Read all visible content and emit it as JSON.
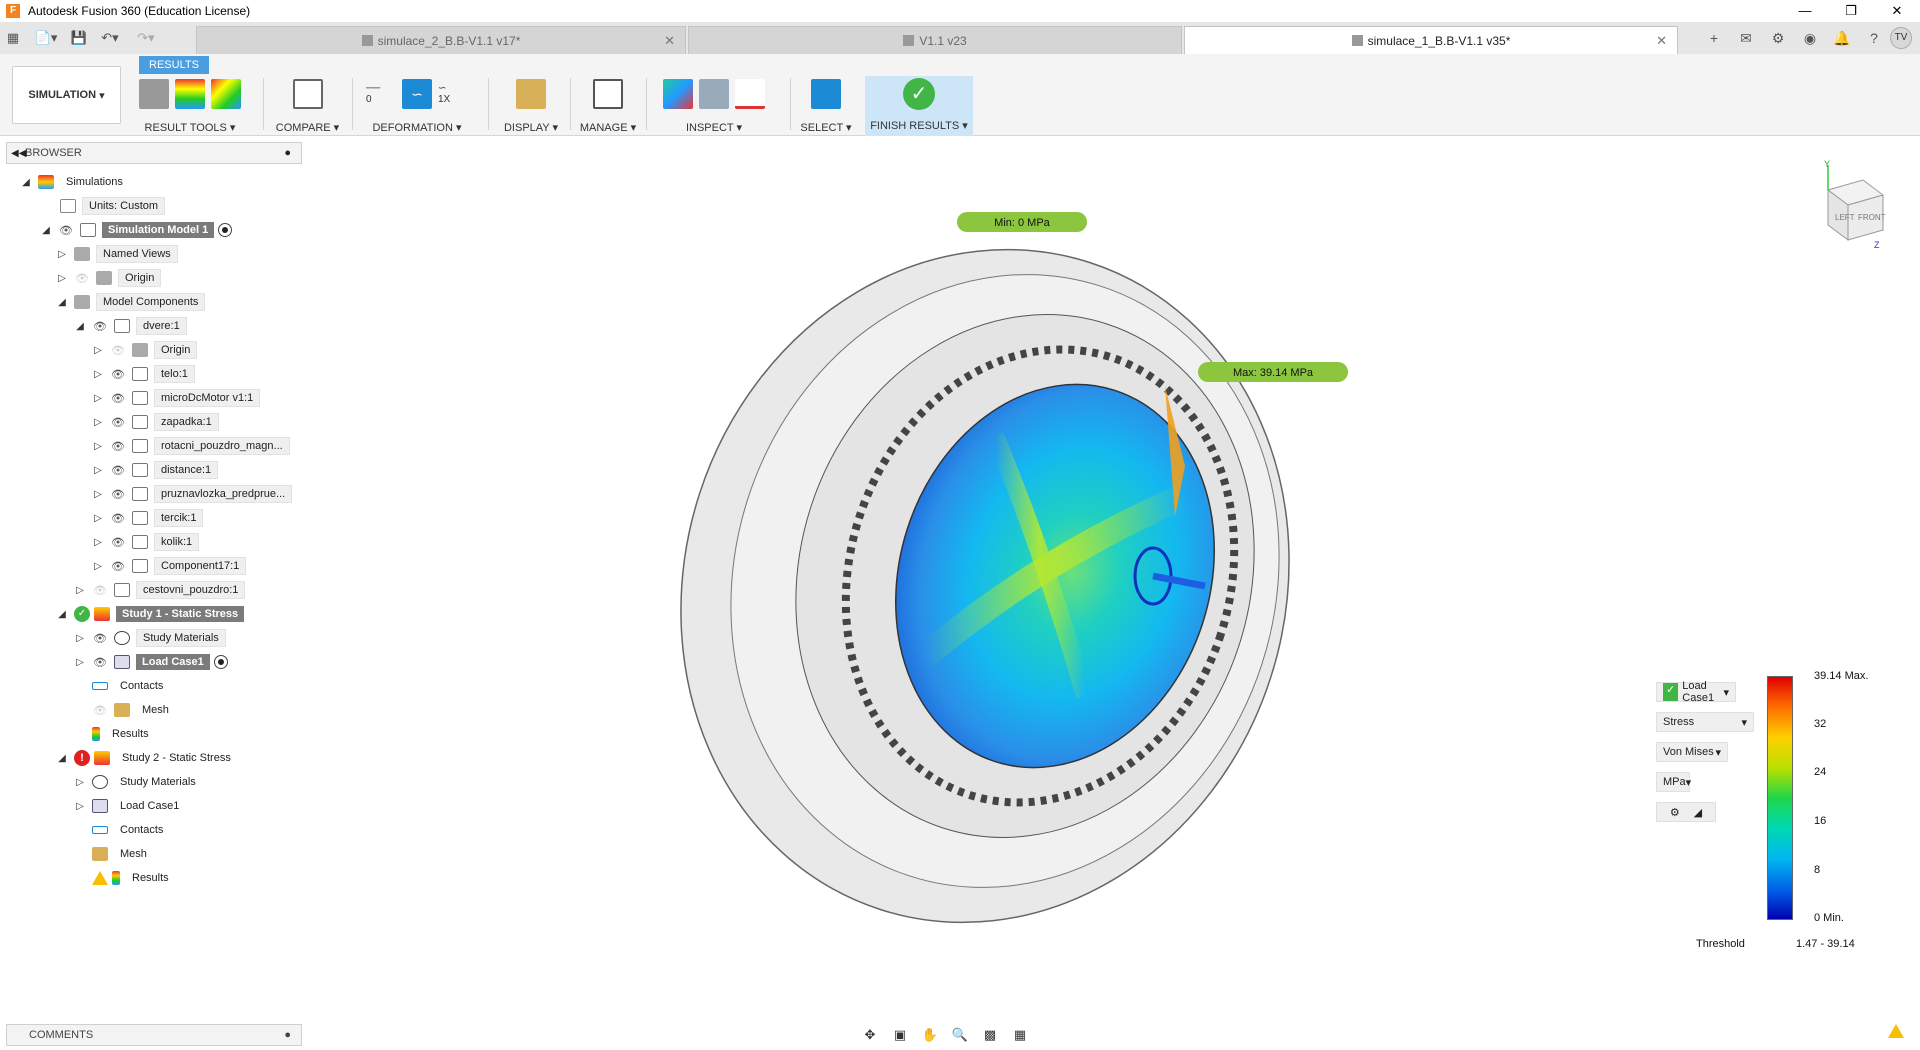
{
  "app": {
    "title": "Autodesk Fusion 360 (Education License)"
  },
  "tabs": [
    {
      "label": "simulace_2_B.B-V1.1 v17*"
    },
    {
      "label": "V1.1 v23"
    },
    {
      "label": "simulace_1_B.B-V1.1 v35*"
    }
  ],
  "user": {
    "initials": "TV"
  },
  "ribbon": {
    "active_tab": "RESULTS",
    "workspace": "SIMULATION",
    "groups": [
      {
        "label": "RESULT TOOLS"
      },
      {
        "label": "COMPARE"
      },
      {
        "label": "DEFORMATION"
      },
      {
        "label": "DISPLAY"
      },
      {
        "label": "MANAGE"
      },
      {
        "label": "INSPECT"
      },
      {
        "label": "SELECT"
      },
      {
        "label": "FINISH RESULTS"
      }
    ],
    "deformation": {
      "zero_label": "0",
      "scale_label": "1X"
    }
  },
  "browser": {
    "title": "BROWSER",
    "items": [
      {
        "label": "Simulations"
      },
      {
        "label": "Units: Custom"
      },
      {
        "label": "Simulation Model 1"
      },
      {
        "label": "Named Views"
      },
      {
        "label": "Origin"
      },
      {
        "label": "Model Components"
      },
      {
        "label": "dvere:1"
      },
      {
        "label": "Origin"
      },
      {
        "label": "telo:1"
      },
      {
        "label": "microDcMotor v1:1"
      },
      {
        "label": "zapadka:1"
      },
      {
        "label": "rotacni_pouzdro_magn..."
      },
      {
        "label": "distance:1"
      },
      {
        "label": "pruznavlozka_predprue..."
      },
      {
        "label": "tercik:1"
      },
      {
        "label": "kolik:1"
      },
      {
        "label": "Component17:1"
      },
      {
        "label": "cestovni_pouzdro:1"
      },
      {
        "label": "Study 1 - Static Stress"
      },
      {
        "label": "Study Materials"
      },
      {
        "label": "Load Case1"
      },
      {
        "label": "Contacts"
      },
      {
        "label": "Mesh"
      },
      {
        "label": "Results"
      },
      {
        "label": "Study 2 - Static Stress"
      },
      {
        "label": "Study Materials"
      },
      {
        "label": "Load Case1"
      },
      {
        "label": "Contacts"
      },
      {
        "label": "Mesh"
      },
      {
        "label": "Results"
      }
    ]
  },
  "viewport": {
    "min_label": "Min: 0 MPa",
    "max_label": "Max: 39.14 MPa",
    "viewcube": {
      "left": "LEFT",
      "front": "FRONT",
      "axis_y": "Y",
      "axis_z": "Z"
    }
  },
  "legend": {
    "load_case": "Load Case1",
    "result_type": "Stress",
    "criterion": "Von Mises",
    "unit": "MPa",
    "ticks": [
      "39.14 Max.",
      "32",
      "24",
      "16",
      "8",
      "0 Min."
    ],
    "threshold_label": "Threshold",
    "threshold_value": "1.47 - 39.14",
    "colors": [
      "#e00000",
      "#ffd000",
      "#1fd64a",
      "#00b7f0",
      "#0000b0"
    ]
  },
  "comments": {
    "title": "COMMENTS"
  }
}
